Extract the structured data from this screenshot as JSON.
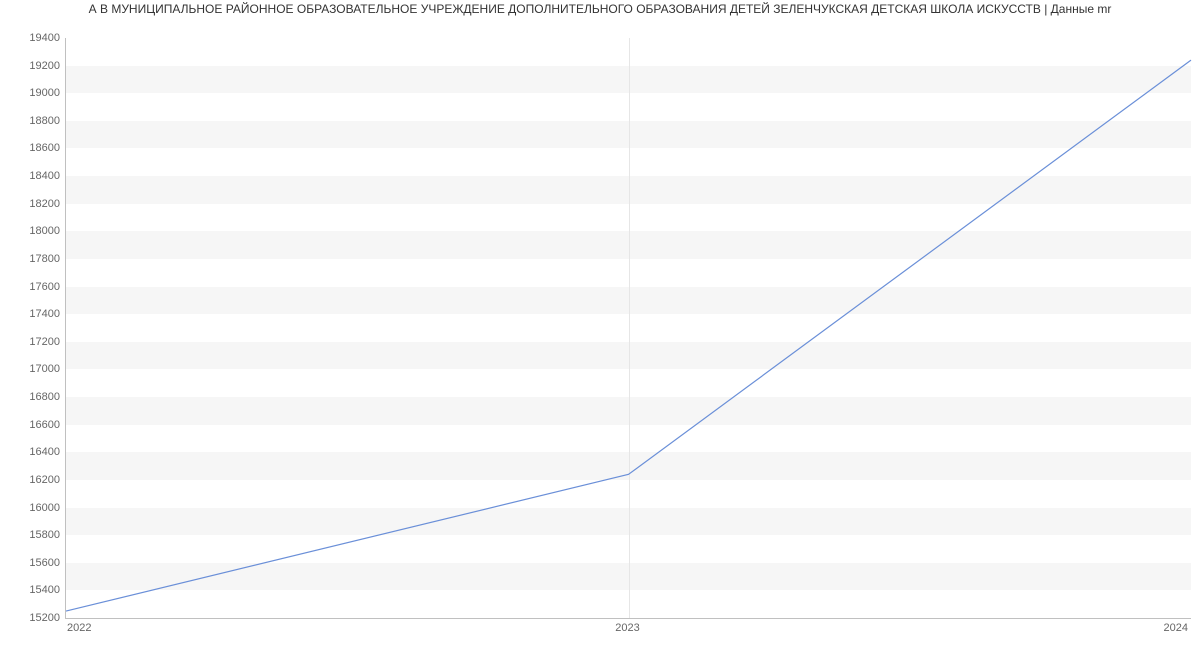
{
  "title": "А В МУНИЦИПАЛЬНОЕ РАЙОННОЕ ОБРАЗОВАТЕЛЬНОЕ УЧРЕЖДЕНИЕ ДОПОЛНИТЕЛЬНОГО ОБРАЗОВАНИЯ ДЕТЕЙ ЗЕЛЕНЧУКСКАЯ ДЕТСКАЯ ШКОЛА ИСКУССТВ | Данные mr",
  "chart_data": {
    "type": "line",
    "x": [
      2022,
      2023,
      2024
    ],
    "y": [
      15250,
      16240,
      19240
    ],
    "xlabel": "",
    "ylabel": "",
    "ylim": [
      15200,
      19400
    ],
    "xticks": [
      2022,
      2023,
      2024
    ],
    "yticks": [
      15200,
      15400,
      15600,
      15800,
      16000,
      16200,
      16400,
      16600,
      16800,
      17000,
      17200,
      17400,
      17600,
      17800,
      18000,
      18200,
      18400,
      18600,
      18800,
      19000,
      19200,
      19400
    ]
  }
}
